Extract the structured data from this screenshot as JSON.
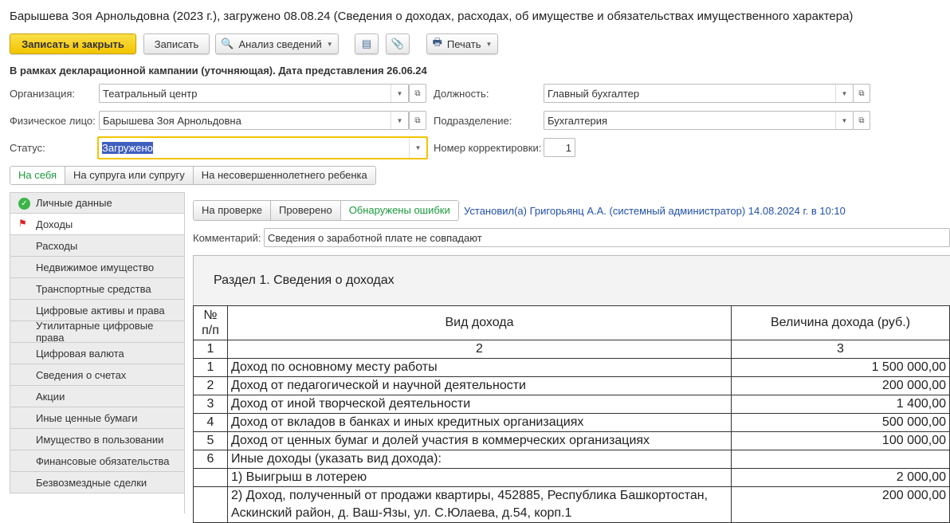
{
  "window": {
    "title": "Барышева Зоя Арнольдовна (2023 г.), загружено 08.08.24 (Сведения о доходах, расходах, об имуществе и обязательствах имущественного характера)"
  },
  "toolbar": {
    "save_close": "Записать и закрыть",
    "save": "Записать",
    "analysis": "Анализ сведений",
    "print": "Печать"
  },
  "campaign_note": "В рамках декларационной кампании (уточняющая). Дата представления 26.06.24",
  "form": {
    "org_label": "Организация:",
    "org_value": "Театральный центр",
    "person_label": "Физическое лицо:",
    "person_value": "Барышева Зоя Арнольдовна",
    "status_label": "Статус:",
    "status_value": "Загружено",
    "position_label": "Должность:",
    "position_value": "Главный бухгалтер",
    "dept_label": "Подразделение:",
    "dept_value": "Бухгалтерия",
    "corr_label": "Номер корректировки:",
    "corr_value": "1"
  },
  "subject_tabs": [
    "На себя",
    "На супруга или супругу",
    "На несовершеннолетнего ребенка"
  ],
  "nav": [
    "Личные данные",
    "Доходы",
    "Расходы",
    "Недвижимое имущество",
    "Транспортные средства",
    "Цифровые активы и права",
    "Утилитарные цифровые права",
    "Цифровая валюта",
    "Сведения о счетах",
    "Акции",
    "Иные ценные бумаги",
    "Имущество в пользовании",
    "Финансовые обязательства",
    "Безвозмездные сделки"
  ],
  "check": {
    "tabs": [
      "На проверке",
      "Проверено",
      "Обнаружены ошибки"
    ],
    "set_by": "Установил(а) Григорьянц А.А. (системный администратор) 14.08.2024 г. в 10:10",
    "comment_label": "Комментарий:",
    "comment_value": "Сведения о заработной плате не совпадают"
  },
  "section": {
    "title": "Раздел 1. Сведения о доходах",
    "headers": [
      "№ п/п",
      "Вид дохода",
      "Величина дохода (руб.)"
    ],
    "col_numbers": [
      "1",
      "2",
      "3"
    ],
    "rows": [
      {
        "n": "1",
        "kind": "Доход по основному месту работы",
        "amount": "1 500 000,00"
      },
      {
        "n": "2",
        "kind": "Доход от педагогической и научной деятельности",
        "amount": "200 000,00"
      },
      {
        "n": "3",
        "kind": "Доход от иной творческой деятельности",
        "amount": "1 400,00"
      },
      {
        "n": "4",
        "kind": "Доход от вкладов в банках и иных кредитных организациях",
        "amount": "500 000,00"
      },
      {
        "n": "5",
        "kind": "Доход от ценных бумаг и долей участия в коммерческих организациях",
        "amount": "100 000,00"
      },
      {
        "n": "6",
        "kind": "Иные доходы (указать вид дохода):",
        "amount": ""
      },
      {
        "n": "",
        "kind": "1) Выигрыш в лотерею",
        "amount": "2 000,00"
      },
      {
        "n": "",
        "kind": "2) Доход, полученный от продажи квартиры, 452885, Республика Башкортостан, Аскинский район, д. Ваш-Язы, ул. С.Юлаева, д.54, корп.1",
        "amount": "200 000,00"
      }
    ]
  }
}
